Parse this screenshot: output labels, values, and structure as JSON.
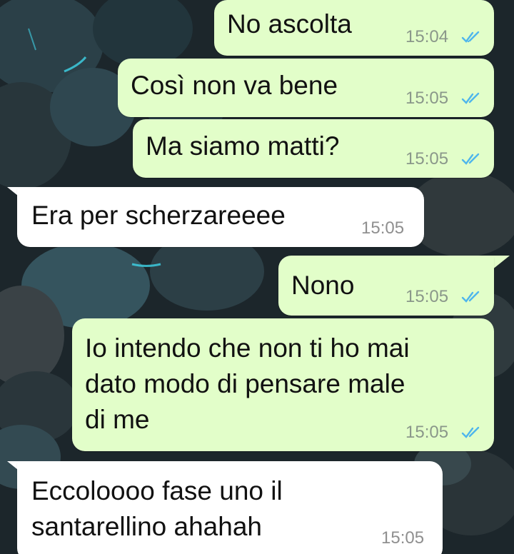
{
  "colors": {
    "outgoing_bubble": "#e2fec9",
    "incoming_bubble": "#ffffff",
    "read_ticks": "#4fb6ec",
    "timestamp": "#8a978a"
  },
  "messages": [
    {
      "direction": "outgoing",
      "text": "No ascolta",
      "time": "15:04",
      "status_icon": "double-check-read-icon"
    },
    {
      "direction": "outgoing",
      "text": "Così non va bene",
      "time": "15:05",
      "status_icon": "double-check-read-icon"
    },
    {
      "direction": "outgoing",
      "text": "Ma siamo matti?",
      "time": "15:05",
      "status_icon": "double-check-read-icon"
    },
    {
      "direction": "incoming",
      "text": "Era per scherzareeee",
      "time": "15:05"
    },
    {
      "direction": "outgoing",
      "text": "Nono",
      "time": "15:05",
      "status_icon": "double-check-read-icon"
    },
    {
      "direction": "outgoing",
      "lines": [
        "Io intendo che non ti ho mai",
        "dato modo di pensare male",
        "di me"
      ],
      "time": "15:05",
      "status_icon": "double-check-read-icon"
    },
    {
      "direction": "incoming",
      "lines": [
        "Eccoloooo fase uno il",
        "santarellino ahahah"
      ],
      "time": "15:05"
    }
  ]
}
